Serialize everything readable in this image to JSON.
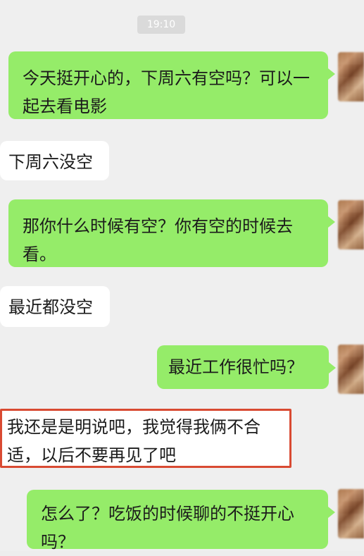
{
  "chat": {
    "timestamp": "19:10",
    "messages": [
      {
        "side": "sent",
        "text": "今天挺开心的，下周六有空吗？可以一起去看电影"
      },
      {
        "side": "received",
        "text": "下周六没空"
      },
      {
        "side": "sent",
        "text": "那你什么时候有空？你有空的时候去看。"
      },
      {
        "side": "received",
        "text": "最近都没空"
      },
      {
        "side": "sent",
        "text": "最近工作很忙吗？"
      },
      {
        "side": "received",
        "text": "我还是是明说吧，我觉得我俩不合适，以后不要再见了吧",
        "highlighted": true
      },
      {
        "side": "sent",
        "text": "怎么了？吃饭的时候聊的不挺开心吗？"
      }
    ]
  },
  "colors": {
    "background": "#efefef",
    "sent_bubble": "#95ec69",
    "received_bubble": "#ffffff",
    "highlight_border": "#d94a32",
    "timestamp_bg": "#dadada"
  },
  "icons": {
    "avatar": "blurred-avatar-icon"
  }
}
